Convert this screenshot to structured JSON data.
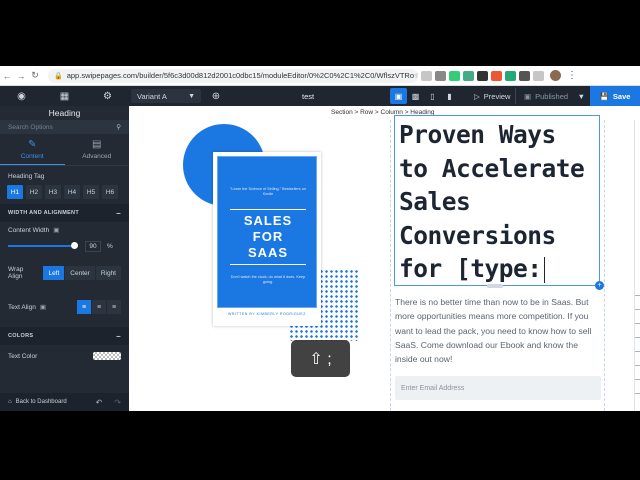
{
  "browser": {
    "url": "app.swipepages.com/builder/5f6c3d00d812d2001c0dbc15/moduleEditor/0%2C0%2C1%2C0/WflszVTRo"
  },
  "topbar": {
    "variant": "Variant A",
    "page_name": "test",
    "preview_label": "Preview",
    "published_label": "Published",
    "save_label": "Save"
  },
  "sidebar": {
    "title": "Heading",
    "search_placeholder": "Search Options",
    "tabs": [
      {
        "label": "Content",
        "icon": "brush-icon",
        "active": true
      },
      {
        "label": "Advanced",
        "icon": "sliders-icon",
        "active": false
      }
    ],
    "heading_tag_label": "Heading Tag",
    "heading_tags": [
      "H1",
      "H2",
      "H3",
      "H4",
      "H5",
      "H6"
    ],
    "heading_tag_selected": "H1",
    "width_section": "WIDTH AND ALIGNMENT",
    "content_width_label": "Content Width",
    "content_width_value": "90",
    "content_width_unit": "%",
    "wrap_align_label": "Wrap Align",
    "wrap_align_options": [
      "Left",
      "Center",
      "Right"
    ],
    "wrap_align_selected": "Left",
    "text_align_label": "Text Align",
    "colors_section": "COLORS",
    "text_color_label": "Text Color",
    "back_label": "Back to Dashboard"
  },
  "canvas": {
    "breadcrumb": "Section >  Row >  Column >  Heading",
    "book": {
      "quote": "\"Learn the Science of Selling.\" Bestsellers on Kindle",
      "title_lines": [
        "SALES",
        "FOR",
        "SAAS"
      ],
      "blurb": "Don't watch the clock; do what it does. Keep going.",
      "author": "WRITTEN BY KIMBERLY RODRIGUEZ"
    },
    "heading_lines": [
      "Proven Ways",
      "to Accelerate",
      "Sales",
      "Conversions",
      "for [type:"
    ],
    "paragraph": "There is no better time than now to be in Saas. But more opportunities means more competition. If you want to lead the pack, you need to know how to sell SaaS. Come download our Ebook and know the inside out now!",
    "email_placeholder": "Enter Email Address",
    "key_overlay": "⇧ ;"
  },
  "colors": {
    "accent": "#1b78e2",
    "dark_bg": "#1f2630",
    "heading": "#1d2533"
  }
}
